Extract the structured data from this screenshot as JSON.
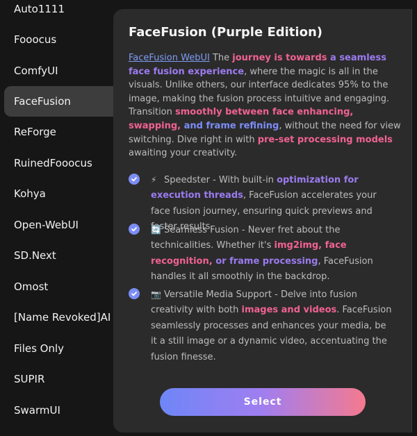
{
  "sidebar": {
    "items": [
      {
        "label": "Auto1111"
      },
      {
        "label": "Fooocus"
      },
      {
        "label": "ComfyUI"
      },
      {
        "label": "FaceFusion"
      },
      {
        "label": "ReForge"
      },
      {
        "label": "RuinedFooocus"
      },
      {
        "label": "Kohya"
      },
      {
        "label": "Open-WebUI"
      },
      {
        "label": "SD.Next"
      },
      {
        "label": "Omost"
      },
      {
        "label": "[Name Revoked]AI"
      },
      {
        "label": "Files Only"
      },
      {
        "label": "SUPIR"
      },
      {
        "label": "SwarmUI"
      }
    ],
    "active": "FaceFusion"
  },
  "panel": {
    "title": "FaceFusion (Purple Edition)",
    "intro": {
      "link": "FaceFusion WebUI",
      "t1": " The ",
      "h1a": "journey is towards",
      "h1b": " a seamless face fusion experience",
      "t2": ", where the magic is all in the visuals. Unlike others, our interface dedicates 95% to the image, making the fusion process intuitive and engaging. Transition ",
      "h2a": "smoothly between face enhancing, swapping,",
      "h2b": " and frame refining",
      "t3": ", without the need for view switching. Dive right in with ",
      "h3": "pre-set processing models",
      "t4": " awaiting your creativity."
    },
    "features": [
      {
        "emoji": "⚡",
        "t1": "Speedster - With built-in ",
        "h1": "optimization for execution threads",
        "t2": ", FaceFusion accelerates your face fusion journey, ensuring quick previews and faster results."
      },
      {
        "emoji": "🔄",
        "t1": "Seamless Fusion - Never fret about the technicalities. Whether it's ",
        "h1a": "img2img, face recognition,",
        "h1b": " or frame processing",
        "t2": ", FaceFusion handles it all smoothly in the backdrop."
      },
      {
        "emoji": "📷",
        "t1": "Versatile Media Support - Delve into fusion creativity with both ",
        "h1": "images and videos",
        "t2": ". FaceFusion seamlessly processes and enhances your media, be it a still image or a dynamic video, accentuating the fusion finesse."
      }
    ],
    "select_label": "Select"
  },
  "colors": {
    "accent_blue": "#7c8df6",
    "accent_purple": "#9b7bf0",
    "accent_pink": "#f06292",
    "panel_bg": "#2b2b2b",
    "page_bg": "#161616"
  }
}
